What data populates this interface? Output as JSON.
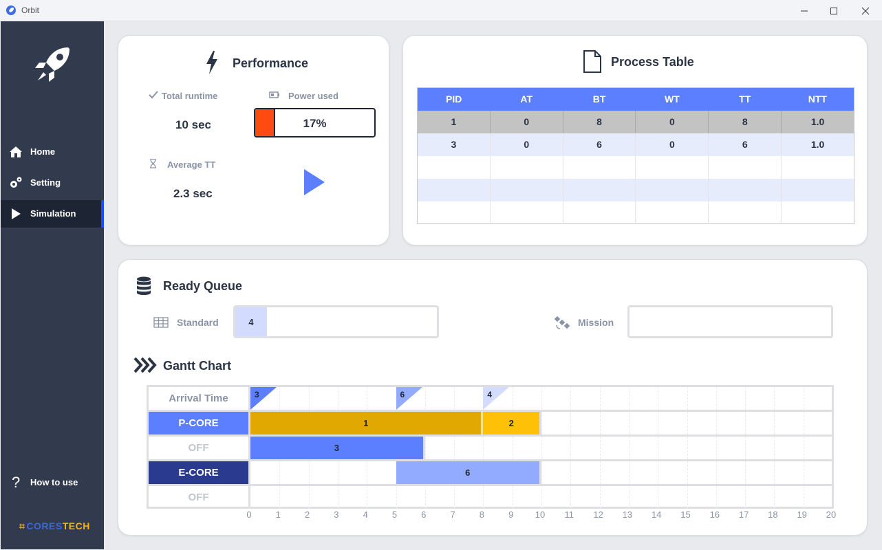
{
  "window": {
    "title": "Orbit"
  },
  "sidebar": {
    "items": [
      {
        "label": "Home",
        "icon": "home-icon"
      },
      {
        "label": "Setting",
        "icon": "gears-icon"
      },
      {
        "label": "Simulation",
        "icon": "play-icon",
        "active": true
      }
    ],
    "help_label": "How to use",
    "brand": {
      "part1": "CORES",
      "part2": "TECH",
      "color1": "#3c67d8",
      "color2": "#f7b500"
    }
  },
  "performance": {
    "title": "Performance",
    "total_runtime_label": "Total runtime",
    "total_runtime_value": "10 sec",
    "power_label": "Power used",
    "power_value": "17%",
    "power_fraction": 0.17,
    "avg_tt_label": "Average TT",
    "avg_tt_value": "2.3 sec"
  },
  "process_table": {
    "title": "Process Table",
    "headers": [
      "PID",
      "AT",
      "BT",
      "WT",
      "TT",
      "NTT"
    ],
    "rows": [
      [
        "1",
        "0",
        "8",
        "0",
        "8",
        "1.0"
      ],
      [
        "3",
        "0",
        "6",
        "0",
        "6",
        "1.0"
      ],
      [
        "",
        "",
        "",
        "",
        "",
        ""
      ],
      [
        "",
        "",
        "",
        "",
        "",
        ""
      ],
      [
        "",
        "",
        "",
        "",
        "",
        ""
      ]
    ]
  },
  "ready_queue": {
    "title": "Ready Queue",
    "standard_label": "Standard",
    "standard_items": [
      "4"
    ],
    "mission_label": "Mission"
  },
  "gantt": {
    "title": "Gantt Chart",
    "arrival_label": "Arrival Time",
    "rows": [
      {
        "label": "P-CORE",
        "style": "p-core"
      },
      {
        "label": "OFF",
        "style": "off"
      },
      {
        "label": "E-CORE",
        "style": "e-core"
      },
      {
        "label": "OFF",
        "style": "off"
      }
    ],
    "arrivals": [
      {
        "pid": "3",
        "time": 0
      },
      {
        "pid": "6",
        "time": 5
      },
      {
        "pid": "4",
        "time": 8
      }
    ],
    "bars": [
      {
        "row": 0,
        "pid": "1",
        "start": 0,
        "end": 8,
        "color": "#e0a800"
      },
      {
        "row": 0,
        "pid": "2",
        "start": 8,
        "end": 10,
        "color": "#ffc107"
      },
      {
        "row": 1,
        "pid": "3",
        "start": 0,
        "end": 6,
        "color": "#5b7fff"
      },
      {
        "row": 2,
        "pid": "6",
        "start": 5,
        "end": 10,
        "color": "#93abff"
      }
    ],
    "ticks": [
      "0",
      "1",
      "2",
      "3",
      "4",
      "5",
      "6",
      "7",
      "8",
      "9",
      "10",
      "11",
      "12",
      "13",
      "14",
      "15",
      "16",
      "17",
      "18",
      "19",
      "20"
    ],
    "colors": {
      "p_core": "#5b7fff",
      "e_core": "#293a8f",
      "off_text": "#c3c5cc",
      "arrival_text": "#8a93a6"
    }
  }
}
